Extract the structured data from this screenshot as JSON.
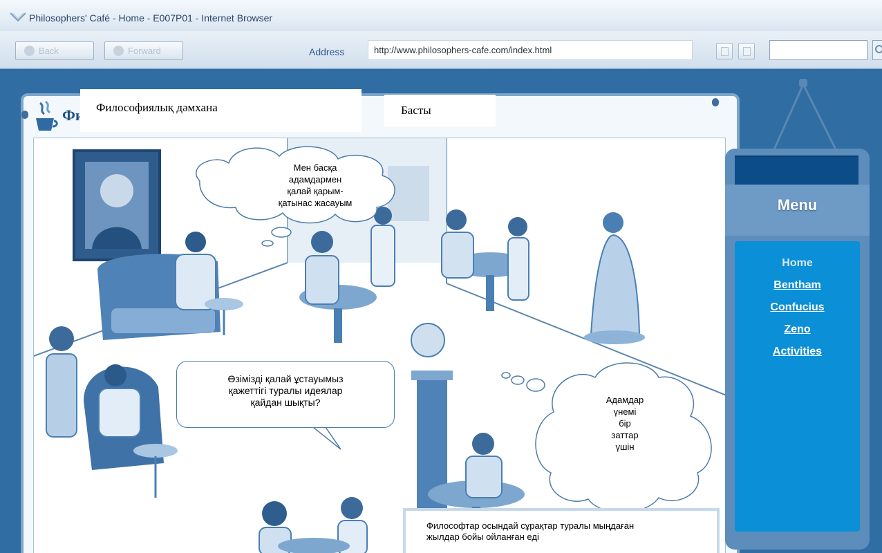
{
  "browser": {
    "window_title": "Philosophers' Café - Home - E007P01 - Internet Browser",
    "back_label": "Back",
    "forward_label": "Forward",
    "address_label": "Address",
    "url": "http://www.philosophers-cafe.com/index.html",
    "search_value": ""
  },
  "page": {
    "logo_text": "Фи",
    "site_title": "Философиялық дәмхана",
    "breadcrumb": "Басты"
  },
  "scene": {
    "thought_top": "Мен басқа адамдармен қалай қарым-қатынас жасауым",
    "thought_top_lines": [
      "Мен басқа",
      "адамдармен",
      "қалай қарым-",
      "қатынас жасауым"
    ],
    "speech_bottom_lines": [
      "Өзімізді қалай ұстауымыз",
      "қажеттігі туралы идеялар",
      "қайдан шықты?"
    ],
    "thought_right_lines": [
      "Адамдар",
      "үнемі",
      "бір",
      "заттар",
      "үшін"
    ],
    "caption_lines": [
      "Философтар осындай  сұрақтар туралы  мыңдаған",
      "жылдар бойы ойланған еді"
    ]
  },
  "menu": {
    "title": "Menu",
    "items": [
      {
        "label": "Home",
        "current": true
      },
      {
        "label": "Bentham",
        "current": false
      },
      {
        "label": "Confucius",
        "current": false
      },
      {
        "label": "Zeno",
        "current": false
      },
      {
        "label": "Activities",
        "current": false
      }
    ]
  },
  "colors": {
    "background": "#2f6da3",
    "menu_board": "#5d8dbb",
    "menu_items_box": "#0b8fd6",
    "scene_ink": "#4a7fb3"
  },
  "icons": [
    "window-logo-icon",
    "back-arrow-icon",
    "forward-arrow-icon",
    "copy-icon",
    "paste-icon",
    "search-icon",
    "coffee-cup-logo-icon"
  ]
}
